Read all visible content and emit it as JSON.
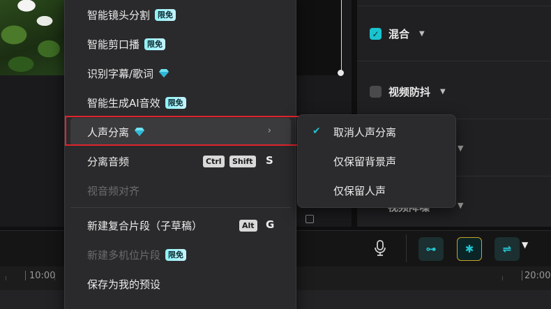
{
  "menu": {
    "items": [
      {
        "label": "智能镜头分割",
        "badge": "限免"
      },
      {
        "label": "智能剪口播",
        "badge": "限免"
      },
      {
        "label": "识别字幕/歌词",
        "icon": "diamond-icon"
      },
      {
        "label": "智能生成AI音效",
        "badge": "限免"
      },
      {
        "label": "人声分离",
        "icon": "diamond-icon",
        "submenu_arrow": "›"
      },
      {
        "label": "分离音频",
        "shortcut": [
          "Ctrl",
          "Shift"
        ],
        "shortcut_key": "S"
      },
      {
        "label": "视音频对齐",
        "disabled": true
      },
      {
        "label": "新建复合片段（子草稿）",
        "shortcut": [
          "Alt"
        ],
        "shortcut_key": "G"
      },
      {
        "label": "新建多机位片段",
        "badge": "限免",
        "disabled": true
      },
      {
        "label": "保存为我的预设"
      }
    ]
  },
  "submenu": {
    "items": [
      {
        "label": "取消人声分离",
        "checked": true
      },
      {
        "label": "仅保留背景声"
      },
      {
        "label": "仅保留人声"
      }
    ]
  },
  "right_panel": {
    "blend_label": "混合",
    "stabilize_label": "视频防抖",
    "partial_label": "视频降噪"
  },
  "timeline": {
    "labels": [
      "10:00",
      "20:00"
    ]
  },
  "colors": {
    "accent": "#19c4cf",
    "highlight_border": "#e0242c",
    "badge_bg": "#8df2f5"
  }
}
